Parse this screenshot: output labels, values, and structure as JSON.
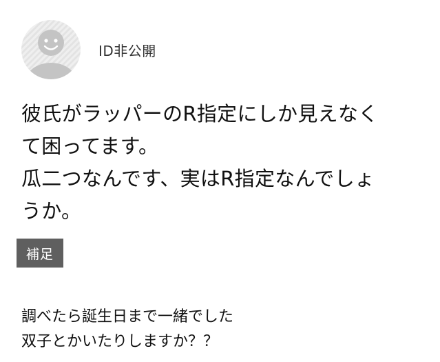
{
  "user": {
    "name": "ID非公開",
    "avatar_icon": "default-avatar-smiley-icon"
  },
  "question": {
    "lines": [
      "彼氏がラッパーのR指定にしか見えなく",
      "て困ってます。",
      "瓜二つなんです、実はR指定なんでしょ",
      "うか。"
    ]
  },
  "supplement": {
    "badge_label": "補足",
    "lines": [
      "調べたら誕生日まで一緒でした",
      "双子とかいたりしますか？？"
    ]
  },
  "colors": {
    "badge_background": "#5f5f5f",
    "avatar_figure": "#c4c4c4"
  }
}
